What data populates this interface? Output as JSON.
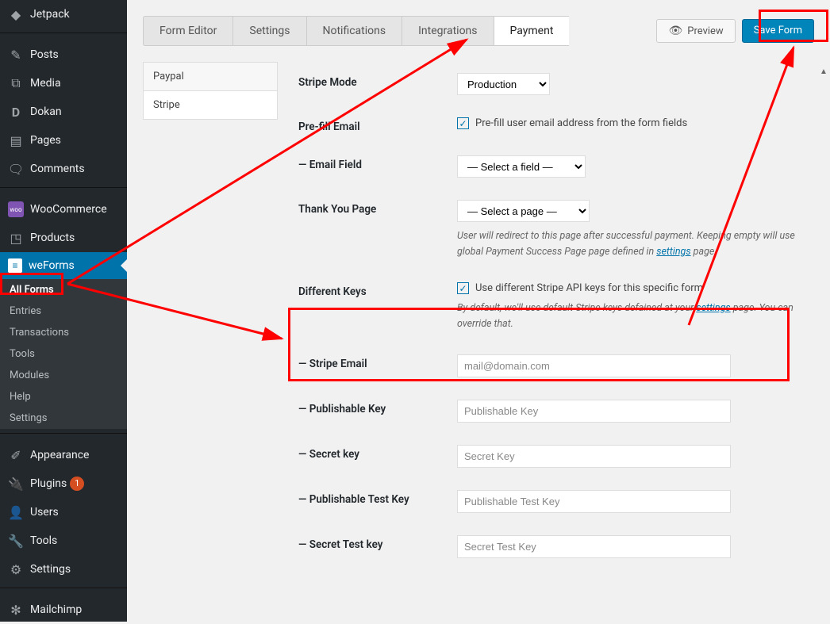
{
  "sidebar": {
    "items": [
      {
        "label": "Jetpack",
        "icon": "◆"
      },
      {
        "label": "Posts",
        "icon": "📌"
      },
      {
        "label": "Media",
        "icon": "🖼"
      },
      {
        "label": "Dokan",
        "icon": "D"
      },
      {
        "label": "Pages",
        "icon": "▤"
      },
      {
        "label": "Comments",
        "icon": "💬"
      },
      {
        "label": "WooCommerce",
        "icon": "woo"
      },
      {
        "label": "Products",
        "icon": "📦"
      },
      {
        "label": "weForms",
        "icon": "W",
        "active": true
      },
      {
        "label": "Appearance",
        "icon": "🖌"
      },
      {
        "label": "Plugins",
        "icon": "🔌",
        "badge": "1"
      },
      {
        "label": "Users",
        "icon": "👤"
      },
      {
        "label": "Tools",
        "icon": "🔧"
      },
      {
        "label": "Settings",
        "icon": "⚙"
      },
      {
        "label": "Mailchimp",
        "icon": "✻"
      }
    ],
    "weforms_submenu": [
      {
        "label": "All Forms",
        "current": true
      },
      {
        "label": "Entries"
      },
      {
        "label": "Transactions"
      },
      {
        "label": "Tools"
      },
      {
        "label": "Modules"
      },
      {
        "label": "Help"
      },
      {
        "label": "Settings"
      }
    ]
  },
  "tabs": {
    "form_editor": "Form Editor",
    "settings": "Settings",
    "notifications": "Notifications",
    "integrations": "Integrations",
    "payment": "Payment"
  },
  "actions": {
    "preview": "Preview",
    "save": "Save Form"
  },
  "payment_subtabs": {
    "paypal": "Paypal",
    "stripe": "Stripe"
  },
  "stripe": {
    "mode_label": "Stripe Mode",
    "mode_value": "Production",
    "prefill_label": "Pre-fill Email",
    "prefill_text": "Pre-fill user email address from the form fields",
    "email_field_label": "— Email Field",
    "email_field_value": "— Select a field —",
    "thank_you_label": "Thank You Page",
    "thank_you_value": "— Select a page —",
    "thank_you_help_1": "User will redirect to this page after successful payment. Keeping empty will use global Payment Success Page page defined in ",
    "thank_you_help_link": "settings",
    "thank_you_help_2": " page.",
    "diff_keys_label": "Different Keys",
    "diff_keys_text": "Use different Stripe API keys for this specific form",
    "diff_keys_help_1": "By default, we'll use default Stripe keys defained at your ",
    "diff_keys_help_link": "settings",
    "diff_keys_help_2": " page. You can override that.",
    "stripe_email_label": "— Stripe Email",
    "stripe_email_placeholder": "mail@domain.com",
    "pub_key_label": "— Publishable Key",
    "pub_key_placeholder": "Publishable Key",
    "secret_key_label": "— Secret key",
    "secret_key_placeholder": "Secret Key",
    "pub_test_key_label": "— Publishable Test Key",
    "pub_test_key_placeholder": "Publishable Test Key",
    "secret_test_key_label": "— Secret Test key",
    "secret_test_key_placeholder": "Secret Test Key"
  }
}
